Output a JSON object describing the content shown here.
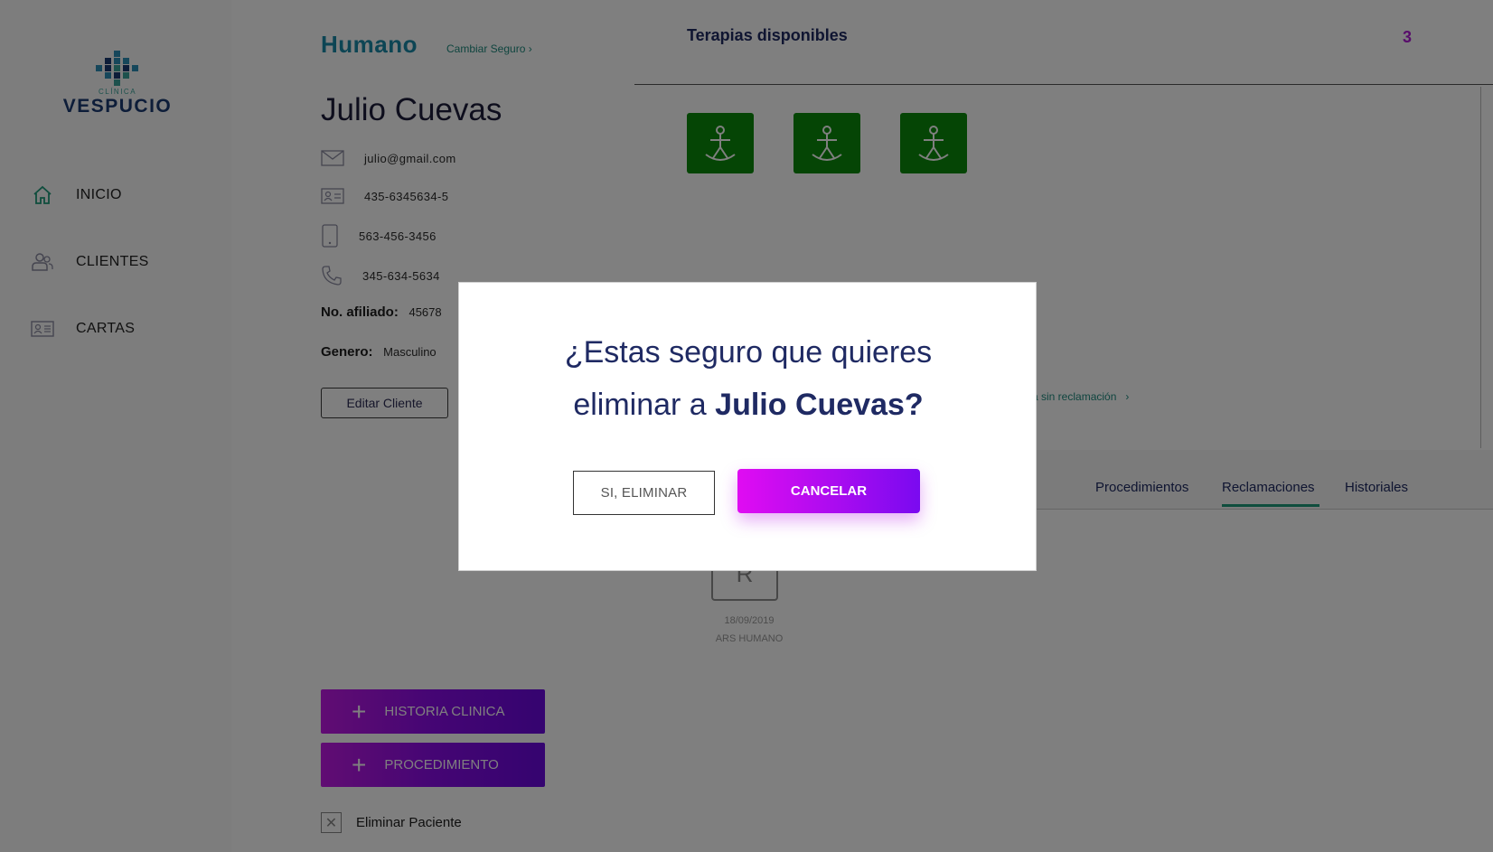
{
  "app": {
    "logo_small": "CLÍNICA",
    "logo_big": "VESPUCIO"
  },
  "sidebar": {
    "items": [
      {
        "label": "INICIO",
        "icon": "home-icon"
      },
      {
        "label": "CLIENTES",
        "icon": "users-icon"
      },
      {
        "label": "CARTAS",
        "icon": "id-card-icon"
      }
    ]
  },
  "patient": {
    "insurer": "Humano",
    "change_insurer": "Cambiar Seguro",
    "name": "Julio Cuevas",
    "email": "julio@gmail.com",
    "id_number": "435-6345634-5",
    "mobile": "563-456-3456",
    "phone": "345-634-5634",
    "affiliate_label": "No. afiliado:",
    "affiliate_value": "45678",
    "gender_label": "Genero:",
    "gender_value": "Masculino",
    "edit_label": "Editar Cliente",
    "history_label": "HISTORIA CLINICA",
    "procedure_label": "PROCEDIMIENTO",
    "delete_label": "Eliminar Paciente"
  },
  "main": {
    "therapies_title": "Terapias disponibles",
    "therapies_count": "3",
    "tiles": [
      "therapy-tile-1",
      "therapy-tile-2",
      "therapy-tile-3"
    ],
    "sin_reclamacion": "a sin reclamación",
    "tabs": [
      "Procedimientos",
      "Reclamaciones",
      "Historiales"
    ],
    "active_tab": "Reclamaciones",
    "record": {
      "letter": "R",
      "date": "18/09/2019",
      "insurer": "ARS HUMANO"
    }
  },
  "modal": {
    "question_line1": "¿Estas seguro que quieres",
    "question_line2_prefix": "eliminar a",
    "question_name": "Julio Cuevas?",
    "confirm_label": "SI, ELIMINAR",
    "cancel_label": "CANCELAR"
  },
  "colors": {
    "accent_purple": "#b01ad6",
    "teal": "#1e8a7e",
    "navy": "#1f2a63",
    "tile_green": "#0b8a0b"
  }
}
